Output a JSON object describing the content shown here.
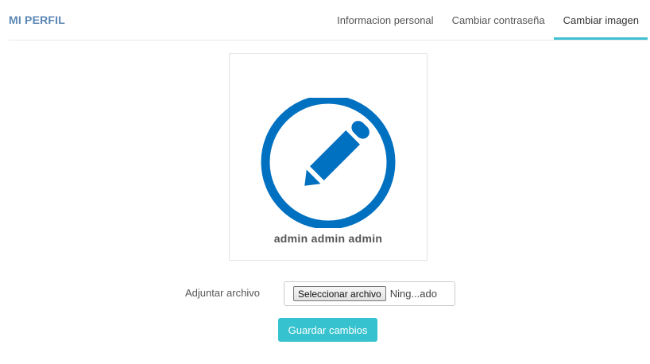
{
  "header": {
    "title": "MI PERFIL",
    "tabs": [
      {
        "label": "Informacion personal",
        "active": false
      },
      {
        "label": "Cambiar contraseña",
        "active": false
      },
      {
        "label": "Cambiar imagen",
        "active": true
      }
    ]
  },
  "profile": {
    "avatar_icon": "pencil-circle-icon",
    "name": "admin admin admin"
  },
  "upload": {
    "label": "Adjuntar archivo",
    "button_label": "Seleccionar archivo",
    "status": "Ning...ado"
  },
  "actions": {
    "save_label": "Guardar cambios"
  },
  "colors": {
    "title": "#5b87b5",
    "active_tab_underline": "#3fc0d2",
    "avatar": "#0070c0",
    "save_button": "#36c3cf"
  }
}
